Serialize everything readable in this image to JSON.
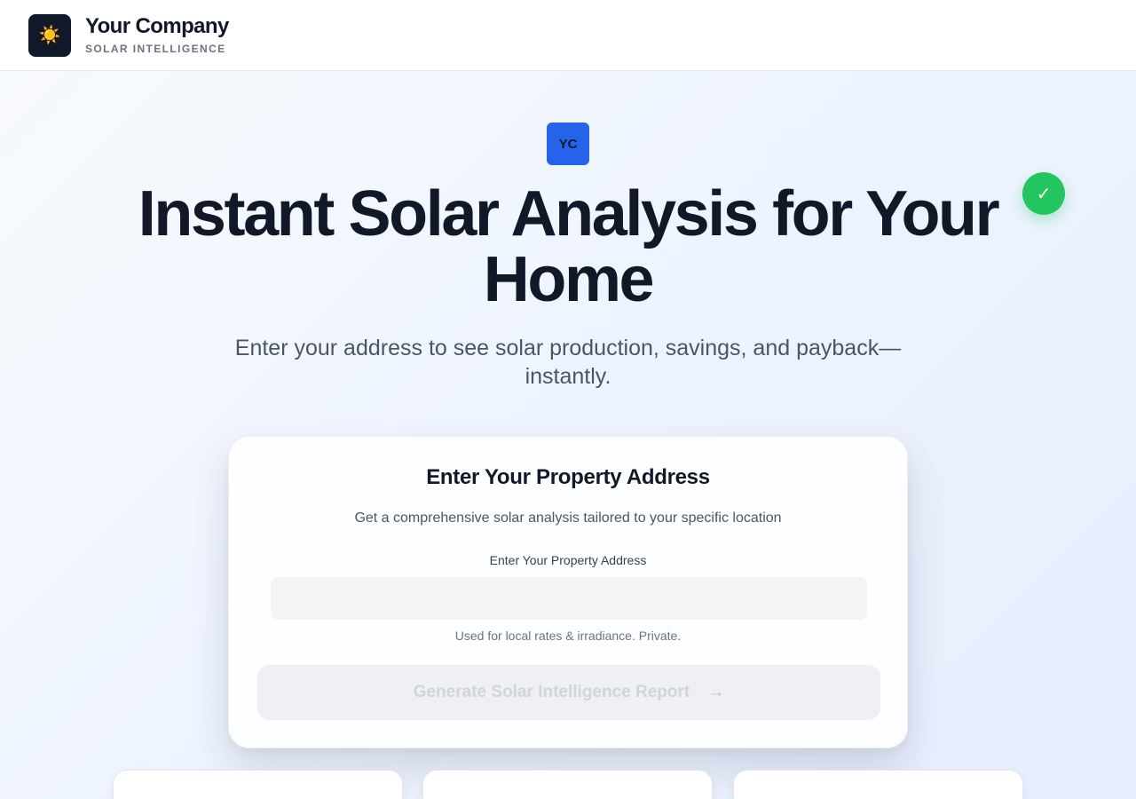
{
  "header": {
    "logo_icon": "sun-icon",
    "logo_glyph": "☀️",
    "brand_name": "Your Company",
    "brand_tagline": "SOLAR INTELLIGENCE"
  },
  "hero": {
    "badge_text": "YC",
    "check_glyph": "✓",
    "title": "Instant Solar Analysis for Your Home",
    "subtitle": "Enter your address to see solar production, savings, and payback—instantly."
  },
  "address_card": {
    "title": "Enter Your Property Address",
    "description": "Get a comprehensive solar analysis tailored to your specific location",
    "field_label": "Enter Your Property Address",
    "field_value": "",
    "field_placeholder": "",
    "field_hint": "Used for local rates & irradiance. Private.",
    "button_label": "Generate Solar Intelligence Report",
    "button_arrow": "→"
  },
  "colors": {
    "accent_blue": "#2563eb",
    "success_green": "#22c55e",
    "dark": "#111827"
  }
}
